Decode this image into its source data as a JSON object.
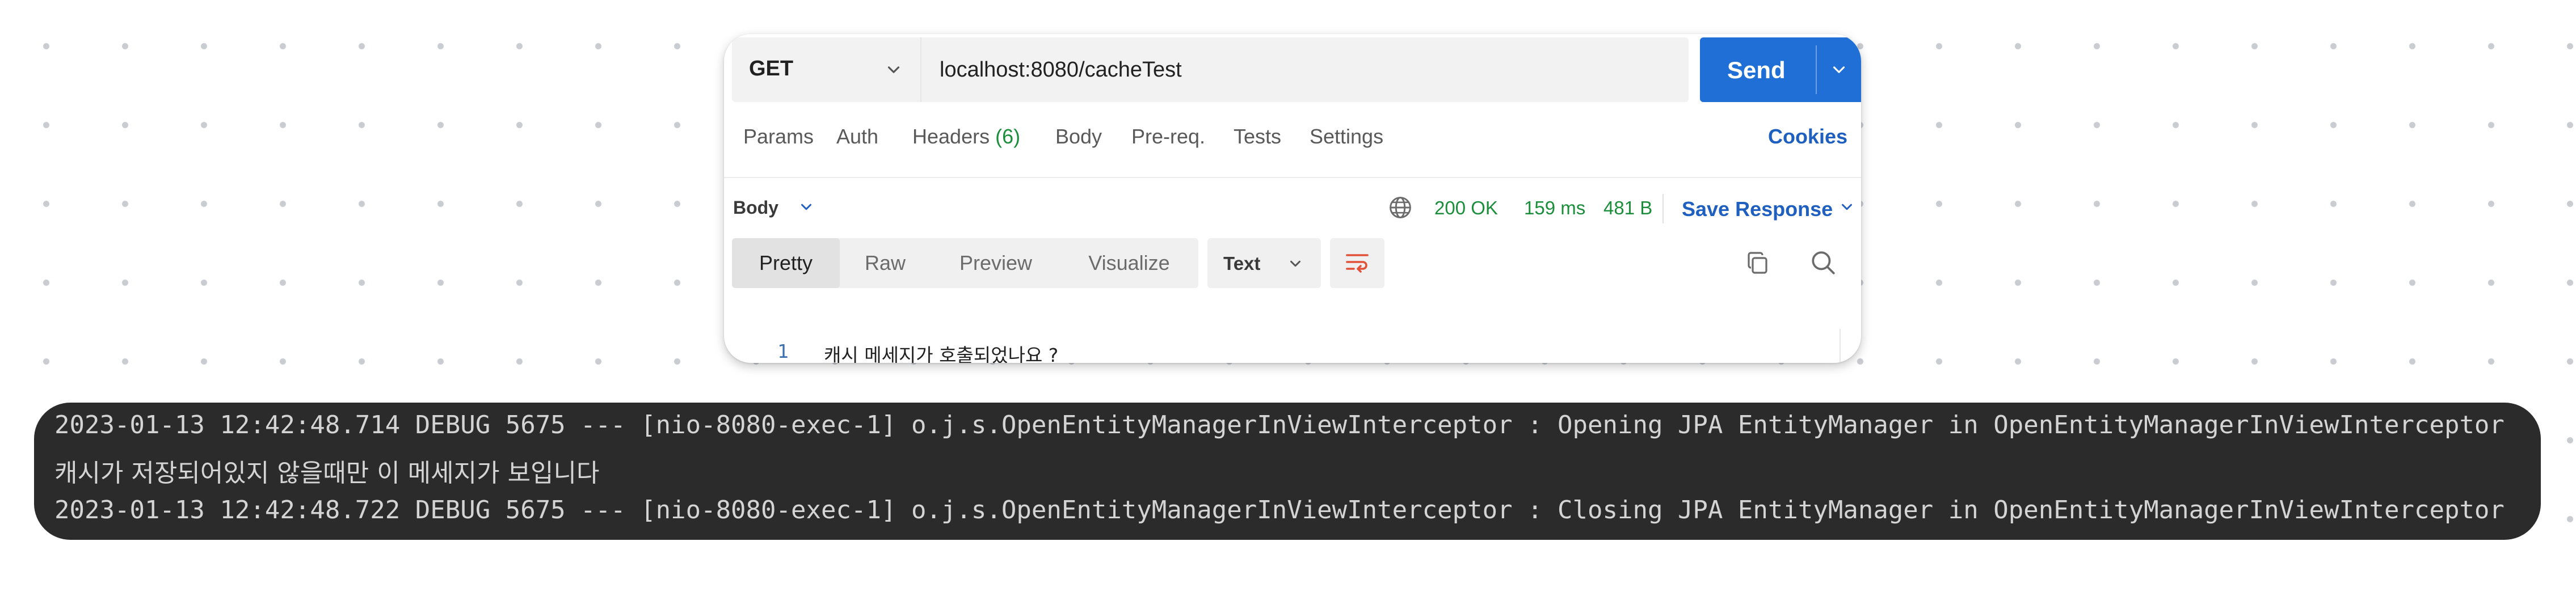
{
  "request": {
    "method": "GET",
    "url": "localhost:8080/cacheTest",
    "send_label": "Send"
  },
  "tabs": {
    "params": "Params",
    "auth": "Auth",
    "headers": "Headers",
    "headers_count": "(6)",
    "body": "Body",
    "prereq": "Pre-req.",
    "tests": "Tests",
    "settings": "Settings",
    "cookies": "Cookies"
  },
  "response": {
    "body_label": "Body",
    "status": "200 OK",
    "time": "159 ms",
    "size": "481 B",
    "save_label": "Save Response"
  },
  "view": {
    "pretty": "Pretty",
    "raw": "Raw",
    "preview": "Preview",
    "visualize": "Visualize",
    "format": "Text"
  },
  "code": {
    "line_number": "1",
    "text": "캐시 메세지가 호출되었나요 ?"
  },
  "console": {
    "lines": [
      "2023-01-13 12:42:48.714 DEBUG 5675 --- [nio-8080-exec-1] o.j.s.OpenEntityManagerInViewInterceptor : Opening JPA EntityManager in OpenEntityManagerInViewInterceptor",
      "캐시가 저장되어있지 않을때만 이 메세지가 보입니다",
      "2023-01-13 12:42:48.722 DEBUG 5675 --- [nio-8080-exec-1] o.j.s.OpenEntityManagerInViewInterceptor : Closing JPA EntityManager in OpenEntityManagerInViewInterceptor"
    ]
  },
  "colors": {
    "send_button": "#1f6fd6",
    "link_blue": "#1f5fbf",
    "status_green": "#1b8e3b",
    "console_bg": "#2b2b2b",
    "wrap_icon_red": "#e2513a"
  },
  "icons": {
    "method": "chevron-down-icon",
    "send": "chevron-down-icon",
    "network": "globe-icon",
    "wrap": "word-wrap-icon",
    "copy": "copy-icon",
    "search": "search-icon"
  }
}
